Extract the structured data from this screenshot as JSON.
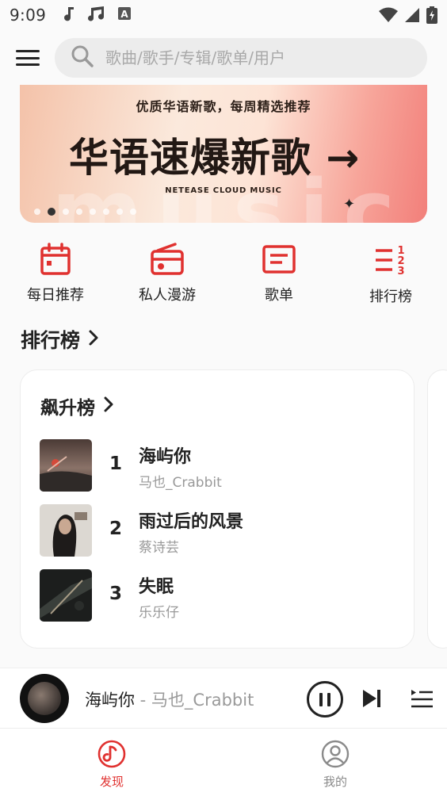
{
  "status_bar": {
    "time": "9:09",
    "notification_icons": [
      "music-note-icon",
      "music-notes-icon",
      "keyboard-a-icon"
    ],
    "system_icons": [
      "wifi-icon",
      "signal-icon",
      "battery-charging-icon"
    ]
  },
  "header": {
    "search_placeholder": "歌曲/歌手/专辑/歌单/用户"
  },
  "banner": {
    "subtitle": "优质华语新歌，每周精选推荐",
    "title": "华语速爆新歌 →",
    "brand": "NETEASE CLOUD MUSIC",
    "watermark": "music",
    "star": "✦",
    "dot_count": 8,
    "active_dot": 1
  },
  "quick_nav": [
    {
      "label": "每日推荐",
      "icon": "calendar-icon"
    },
    {
      "label": "私人漫游",
      "icon": "radio-icon"
    },
    {
      "label": "歌单",
      "icon": "playlist-icon"
    },
    {
      "label": "排行榜",
      "icon": "ranking-icon"
    }
  ],
  "section": {
    "title": "排行榜"
  },
  "chart_card": {
    "title": "飙升榜",
    "songs": [
      {
        "rank": "1",
        "name": "海屿你",
        "artist": "马也_Crabbit"
      },
      {
        "rank": "2",
        "name": "雨过后的风景",
        "artist": "蔡诗芸"
      },
      {
        "rank": "3",
        "name": "失眠",
        "artist": "乐乐仔"
      }
    ]
  },
  "player": {
    "title": "海屿你",
    "artist": " - 马也_Crabbit"
  },
  "bottom_nav": [
    {
      "label": "发现",
      "icon": "discover-icon",
      "active": true
    },
    {
      "label": "我的",
      "icon": "profile-icon",
      "active": false
    }
  ],
  "colors": {
    "accent": "#e0312f",
    "text": "#222222",
    "muted": "#999999"
  }
}
